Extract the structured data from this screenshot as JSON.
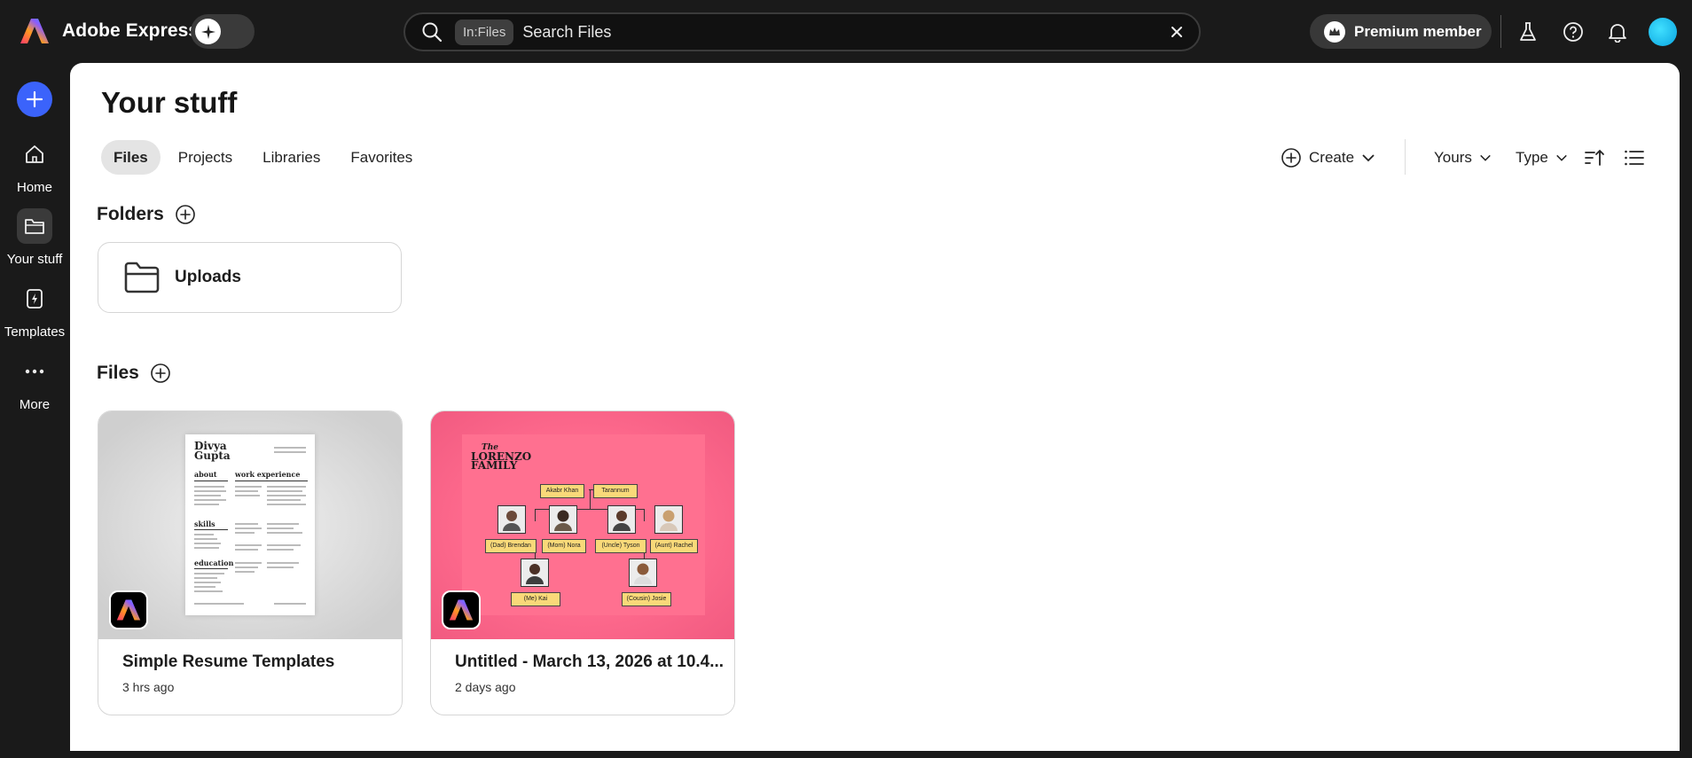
{
  "app": {
    "name": "Adobe Express",
    "brand_color": "#3b63fb"
  },
  "search": {
    "chip": "In:Files",
    "placeholder": "Search Files"
  },
  "topbar": {
    "premium_label": "Premium member"
  },
  "nav": {
    "items": [
      {
        "label": "Home",
        "icon": "home-icon"
      },
      {
        "label": "Your stuff",
        "icon": "folder-icon"
      },
      {
        "label": "Templates",
        "icon": "templates-icon"
      },
      {
        "label": "More",
        "icon": "more-icon"
      }
    ]
  },
  "page": {
    "title": "Your stuff",
    "tabs": [
      "Files",
      "Projects",
      "Libraries",
      "Favorites"
    ],
    "active_tab": "Files"
  },
  "toolbar": {
    "create_label": "Create",
    "owner_filter": "Yours",
    "type_filter": "Type"
  },
  "folders": {
    "title": "Folders",
    "items": [
      {
        "name": "Uploads"
      }
    ]
  },
  "files": {
    "title": "Files",
    "items": [
      {
        "name": "Simple Resume Templates",
        "time": "3 hrs ago"
      },
      {
        "name": "Untitled - March 13, 2026 at 10.4...",
        "time": "2 days ago"
      }
    ]
  },
  "resume_preview": {
    "first_name": "Divya",
    "last_name": "Gupta",
    "sections": [
      "about",
      "work experience",
      "skills",
      "education"
    ]
  },
  "tree_preview": {
    "title_small": "The",
    "title_line1": "LORENZO",
    "title_line2": "FAMILY",
    "grandparents": [
      "Akabr Khan",
      "Tarannum"
    ],
    "parents": [
      "(Dad) Brendan",
      "(Mom) Nora",
      "(Uncle) Tyson",
      "(Aunt) Rachel"
    ],
    "children": [
      "(Me) Kai",
      "(Cousin) Josie"
    ]
  }
}
